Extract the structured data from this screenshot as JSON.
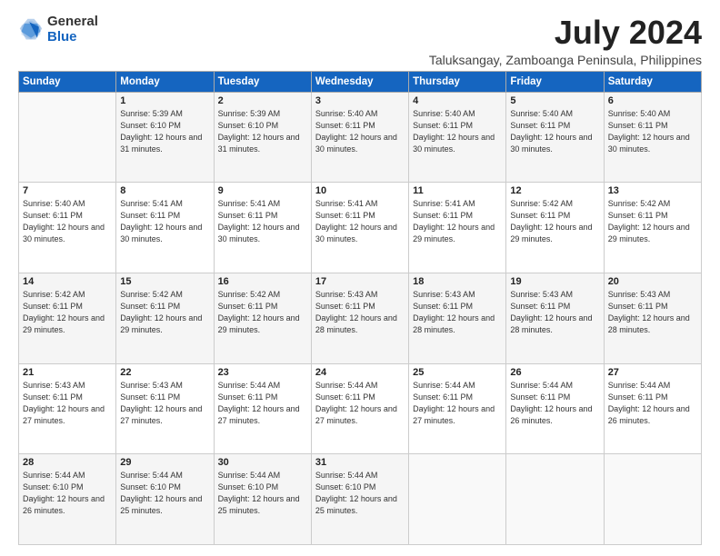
{
  "logo": {
    "general": "General",
    "blue": "Blue"
  },
  "title": "July 2024",
  "location": "Taluksangay, Zamboanga Peninsula, Philippines",
  "weekdays": [
    "Sunday",
    "Monday",
    "Tuesday",
    "Wednesday",
    "Thursday",
    "Friday",
    "Saturday"
  ],
  "weeks": [
    [
      {
        "day": "",
        "sunrise": "",
        "sunset": "",
        "daylight": ""
      },
      {
        "day": "1",
        "sunrise": "Sunrise: 5:39 AM",
        "sunset": "Sunset: 6:10 PM",
        "daylight": "Daylight: 12 hours and 31 minutes."
      },
      {
        "day": "2",
        "sunrise": "Sunrise: 5:39 AM",
        "sunset": "Sunset: 6:10 PM",
        "daylight": "Daylight: 12 hours and 31 minutes."
      },
      {
        "day": "3",
        "sunrise": "Sunrise: 5:40 AM",
        "sunset": "Sunset: 6:11 PM",
        "daylight": "Daylight: 12 hours and 30 minutes."
      },
      {
        "day": "4",
        "sunrise": "Sunrise: 5:40 AM",
        "sunset": "Sunset: 6:11 PM",
        "daylight": "Daylight: 12 hours and 30 minutes."
      },
      {
        "day": "5",
        "sunrise": "Sunrise: 5:40 AM",
        "sunset": "Sunset: 6:11 PM",
        "daylight": "Daylight: 12 hours and 30 minutes."
      },
      {
        "day": "6",
        "sunrise": "Sunrise: 5:40 AM",
        "sunset": "Sunset: 6:11 PM",
        "daylight": "Daylight: 12 hours and 30 minutes."
      }
    ],
    [
      {
        "day": "7",
        "sunrise": "Sunrise: 5:40 AM",
        "sunset": "Sunset: 6:11 PM",
        "daylight": "Daylight: 12 hours and 30 minutes."
      },
      {
        "day": "8",
        "sunrise": "Sunrise: 5:41 AM",
        "sunset": "Sunset: 6:11 PM",
        "daylight": "Daylight: 12 hours and 30 minutes."
      },
      {
        "day": "9",
        "sunrise": "Sunrise: 5:41 AM",
        "sunset": "Sunset: 6:11 PM",
        "daylight": "Daylight: 12 hours and 30 minutes."
      },
      {
        "day": "10",
        "sunrise": "Sunrise: 5:41 AM",
        "sunset": "Sunset: 6:11 PM",
        "daylight": "Daylight: 12 hours and 30 minutes."
      },
      {
        "day": "11",
        "sunrise": "Sunrise: 5:41 AM",
        "sunset": "Sunset: 6:11 PM",
        "daylight": "Daylight: 12 hours and 29 minutes."
      },
      {
        "day": "12",
        "sunrise": "Sunrise: 5:42 AM",
        "sunset": "Sunset: 6:11 PM",
        "daylight": "Daylight: 12 hours and 29 minutes."
      },
      {
        "day": "13",
        "sunrise": "Sunrise: 5:42 AM",
        "sunset": "Sunset: 6:11 PM",
        "daylight": "Daylight: 12 hours and 29 minutes."
      }
    ],
    [
      {
        "day": "14",
        "sunrise": "Sunrise: 5:42 AM",
        "sunset": "Sunset: 6:11 PM",
        "daylight": "Daylight: 12 hours and 29 minutes."
      },
      {
        "day": "15",
        "sunrise": "Sunrise: 5:42 AM",
        "sunset": "Sunset: 6:11 PM",
        "daylight": "Daylight: 12 hours and 29 minutes."
      },
      {
        "day": "16",
        "sunrise": "Sunrise: 5:42 AM",
        "sunset": "Sunset: 6:11 PM",
        "daylight": "Daylight: 12 hours and 29 minutes."
      },
      {
        "day": "17",
        "sunrise": "Sunrise: 5:43 AM",
        "sunset": "Sunset: 6:11 PM",
        "daylight": "Daylight: 12 hours and 28 minutes."
      },
      {
        "day": "18",
        "sunrise": "Sunrise: 5:43 AM",
        "sunset": "Sunset: 6:11 PM",
        "daylight": "Daylight: 12 hours and 28 minutes."
      },
      {
        "day": "19",
        "sunrise": "Sunrise: 5:43 AM",
        "sunset": "Sunset: 6:11 PM",
        "daylight": "Daylight: 12 hours and 28 minutes."
      },
      {
        "day": "20",
        "sunrise": "Sunrise: 5:43 AM",
        "sunset": "Sunset: 6:11 PM",
        "daylight": "Daylight: 12 hours and 28 minutes."
      }
    ],
    [
      {
        "day": "21",
        "sunrise": "Sunrise: 5:43 AM",
        "sunset": "Sunset: 6:11 PM",
        "daylight": "Daylight: 12 hours and 27 minutes."
      },
      {
        "day": "22",
        "sunrise": "Sunrise: 5:43 AM",
        "sunset": "Sunset: 6:11 PM",
        "daylight": "Daylight: 12 hours and 27 minutes."
      },
      {
        "day": "23",
        "sunrise": "Sunrise: 5:44 AM",
        "sunset": "Sunset: 6:11 PM",
        "daylight": "Daylight: 12 hours and 27 minutes."
      },
      {
        "day": "24",
        "sunrise": "Sunrise: 5:44 AM",
        "sunset": "Sunset: 6:11 PM",
        "daylight": "Daylight: 12 hours and 27 minutes."
      },
      {
        "day": "25",
        "sunrise": "Sunrise: 5:44 AM",
        "sunset": "Sunset: 6:11 PM",
        "daylight": "Daylight: 12 hours and 27 minutes."
      },
      {
        "day": "26",
        "sunrise": "Sunrise: 5:44 AM",
        "sunset": "Sunset: 6:11 PM",
        "daylight": "Daylight: 12 hours and 26 minutes."
      },
      {
        "day": "27",
        "sunrise": "Sunrise: 5:44 AM",
        "sunset": "Sunset: 6:11 PM",
        "daylight": "Daylight: 12 hours and 26 minutes."
      }
    ],
    [
      {
        "day": "28",
        "sunrise": "Sunrise: 5:44 AM",
        "sunset": "Sunset: 6:10 PM",
        "daylight": "Daylight: 12 hours and 26 minutes."
      },
      {
        "day": "29",
        "sunrise": "Sunrise: 5:44 AM",
        "sunset": "Sunset: 6:10 PM",
        "daylight": "Daylight: 12 hours and 25 minutes."
      },
      {
        "day": "30",
        "sunrise": "Sunrise: 5:44 AM",
        "sunset": "Sunset: 6:10 PM",
        "daylight": "Daylight: 12 hours and 25 minutes."
      },
      {
        "day": "31",
        "sunrise": "Sunrise: 5:44 AM",
        "sunset": "Sunset: 6:10 PM",
        "daylight": "Daylight: 12 hours and 25 minutes."
      },
      {
        "day": "",
        "sunrise": "",
        "sunset": "",
        "daylight": ""
      },
      {
        "day": "",
        "sunrise": "",
        "sunset": "",
        "daylight": ""
      },
      {
        "day": "",
        "sunrise": "",
        "sunset": "",
        "daylight": ""
      }
    ]
  ]
}
